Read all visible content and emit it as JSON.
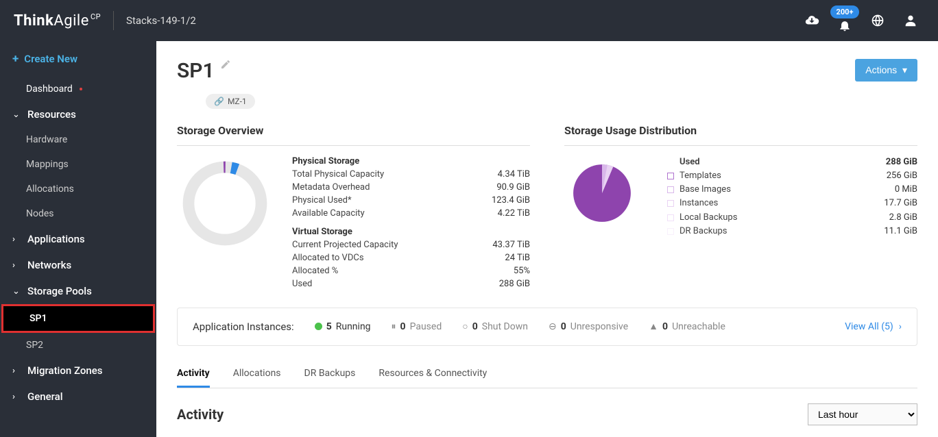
{
  "topbar": {
    "brand_bold": "Think",
    "brand_rest": "Agile",
    "brand_suffix": "CP",
    "stack": "Stacks-149-1/2",
    "notif_badge": "200+"
  },
  "sidebar": {
    "create": "Create New",
    "dashboard": "Dashboard",
    "resources": "Resources",
    "hardware": "Hardware",
    "mappings": "Mappings",
    "allocations": "Allocations",
    "nodes": "Nodes",
    "applications": "Applications",
    "networks": "Networks",
    "storage_pools": "Storage Pools",
    "sp1": "SP1",
    "sp2": "SP2",
    "migration_zones": "Migration Zones",
    "general": "General"
  },
  "page": {
    "title": "SP1",
    "actions": "Actions",
    "mz_chip": "MZ-1"
  },
  "overview": {
    "title": "Storage Overview",
    "phys_title": "Physical Storage",
    "phys": {
      "total_label": "Total Physical Capacity",
      "total": "4.34 TiB",
      "meta_label": "Metadata Overhead",
      "meta": "90.9 GiB",
      "used_label": "Physical Used*",
      "used": "123.4 GiB",
      "avail_label": "Available Capacity",
      "avail": "4.22 TiB"
    },
    "virt_title": "Virtual Storage",
    "virt": {
      "proj_label": "Current Projected Capacity",
      "proj": "43.37 TiB",
      "alloc_label": "Allocated to VDCs",
      "alloc": "24 TiB",
      "pct_label": "Allocated %",
      "pct": "55%",
      "used_label": "Used",
      "used": "288 GiB"
    }
  },
  "usage": {
    "title": "Storage Usage Distribution",
    "used_label": "Used",
    "used_val": "288 GiB",
    "items": {
      "templates": {
        "label": "Templates",
        "val": "256 GiB",
        "color": "#b073cf"
      },
      "base": {
        "label": "Base Images",
        "val": "0 MiB",
        "color": "#e4c2f0"
      },
      "instances": {
        "label": "Instances",
        "val": "17.7 GiB",
        "color": "#f0d8f8"
      },
      "local": {
        "label": "Local Backups",
        "val": "2.8 GiB",
        "color": "#f8ecfc"
      },
      "dr": {
        "label": "DR Backups",
        "val": "11.1 GiB",
        "color": "#fcf6fe"
      }
    }
  },
  "instances": {
    "label": "Application Instances:",
    "running_n": "5",
    "running_l": "Running",
    "paused_n": "0",
    "paused_l": "Paused",
    "shut_n": "0",
    "shut_l": "Shut Down",
    "unresp_n": "0",
    "unresp_l": "Unresponsive",
    "unreach_n": "0",
    "unreach_l": "Unreachable",
    "view_all": "View All (5)"
  },
  "tabs": {
    "activity": "Activity",
    "allocations": "Allocations",
    "dr": "DR Backups",
    "resources": "Resources & Connectivity"
  },
  "activity": {
    "title": "Activity",
    "time_filter": "Last hour"
  },
  "chart_data": [
    {
      "type": "pie",
      "title": "Storage Overview (donut)",
      "series": [
        {
          "name": "Physical Used",
          "value_gib": 123.4,
          "color": "#2e8ae6"
        },
        {
          "name": "Available",
          "value_gib": 4321,
          "color": "#e6e6e6"
        }
      ],
      "total_tib": 4.34,
      "note": "thin donut; tiny purple tick at top indicates metadata overhead 90.9 GiB"
    },
    {
      "type": "pie",
      "title": "Storage Usage Distribution",
      "total_gib": 288,
      "series": [
        {
          "name": "Templates",
          "value_gib": 256,
          "color": "#8e44ad"
        },
        {
          "name": "Base Images",
          "value_gib": 0,
          "color": "#e4c2f0"
        },
        {
          "name": "Instances",
          "value_gib": 17.7,
          "color": "#f0d8f8"
        },
        {
          "name": "Local Backups",
          "value_gib": 2.8,
          "color": "#f8ecfc"
        },
        {
          "name": "DR Backups",
          "value_gib": 11.1,
          "color": "#fcf6fe"
        }
      ]
    }
  ]
}
